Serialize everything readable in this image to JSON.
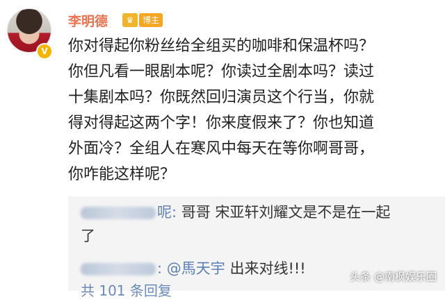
{
  "author": {
    "name": "李明德",
    "badge_label": "博主",
    "verified_mark": "V",
    "crown_icon": "crown-icon"
  },
  "post": {
    "lines": [
      "你对得起你粉丝给全组买的咖啡和保温杯吗？",
      "你但凡看一眼剧本呢？你读过全剧本吗？读过",
      "十集剧本吗？你既然回归演员这个行当，你就",
      "得对得起这两个字！你来度假来了？你也知道",
      "外面冷？全组人在寒风中每天在等你啊哥哥，",
      "你咋能这样呢？"
    ]
  },
  "replies": [
    {
      "name_suffix": "呢:",
      "text_line1": " 哥哥 宋亚轩刘耀文是不是在一起",
      "text_line2": "了"
    },
    {
      "name_suffix": ":",
      "mention": " @馬天宇",
      "text": " 出来对线!!!"
    }
  ],
  "more_replies": "共 101 条回复",
  "watermark": "头条 @南枫娱乐圈"
}
